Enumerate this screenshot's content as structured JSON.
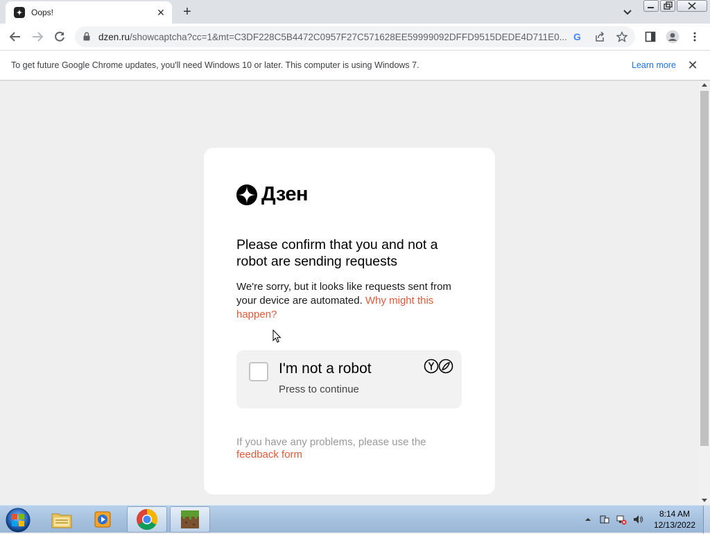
{
  "browser": {
    "tab": {
      "title": "Oops!",
      "favicon": "dzen-favicon",
      "close_icon": "close-icon"
    },
    "new_tab_label": "+",
    "address": {
      "host": "dzen.ru",
      "path": "/showcaptcha?cc=1&mt=C3DF228C5B4472C0957F27C571628EE59999092DFFD9515DEDE4D711E0..."
    },
    "infobar": {
      "message": "To get future Google Chrome updates, you'll need Windows 10 or later. This computer is using Windows 7.",
      "link": "Learn more"
    }
  },
  "page": {
    "logo_text": "Дзен",
    "heading": "Please confirm that you and not a robot are sending requests",
    "description": "We're sorry, but it looks like requests sent from your device are automated. ",
    "description_link": "Why might this happen?",
    "captcha": {
      "title": "I'm not a robot",
      "subtitle": "Press to continue",
      "checked": false
    },
    "footer_text": "If you have any problems, please use the ",
    "footer_link": "feedback form"
  },
  "taskbar": {
    "apps": [
      "windows-explorer",
      "media-player",
      "google-chrome",
      "minecraft"
    ],
    "clock_time": "8:14 AM",
    "clock_date": "12/13/2022"
  },
  "colors": {
    "accent_link": "#e05a3a",
    "chrome_link": "#1a73e8"
  }
}
